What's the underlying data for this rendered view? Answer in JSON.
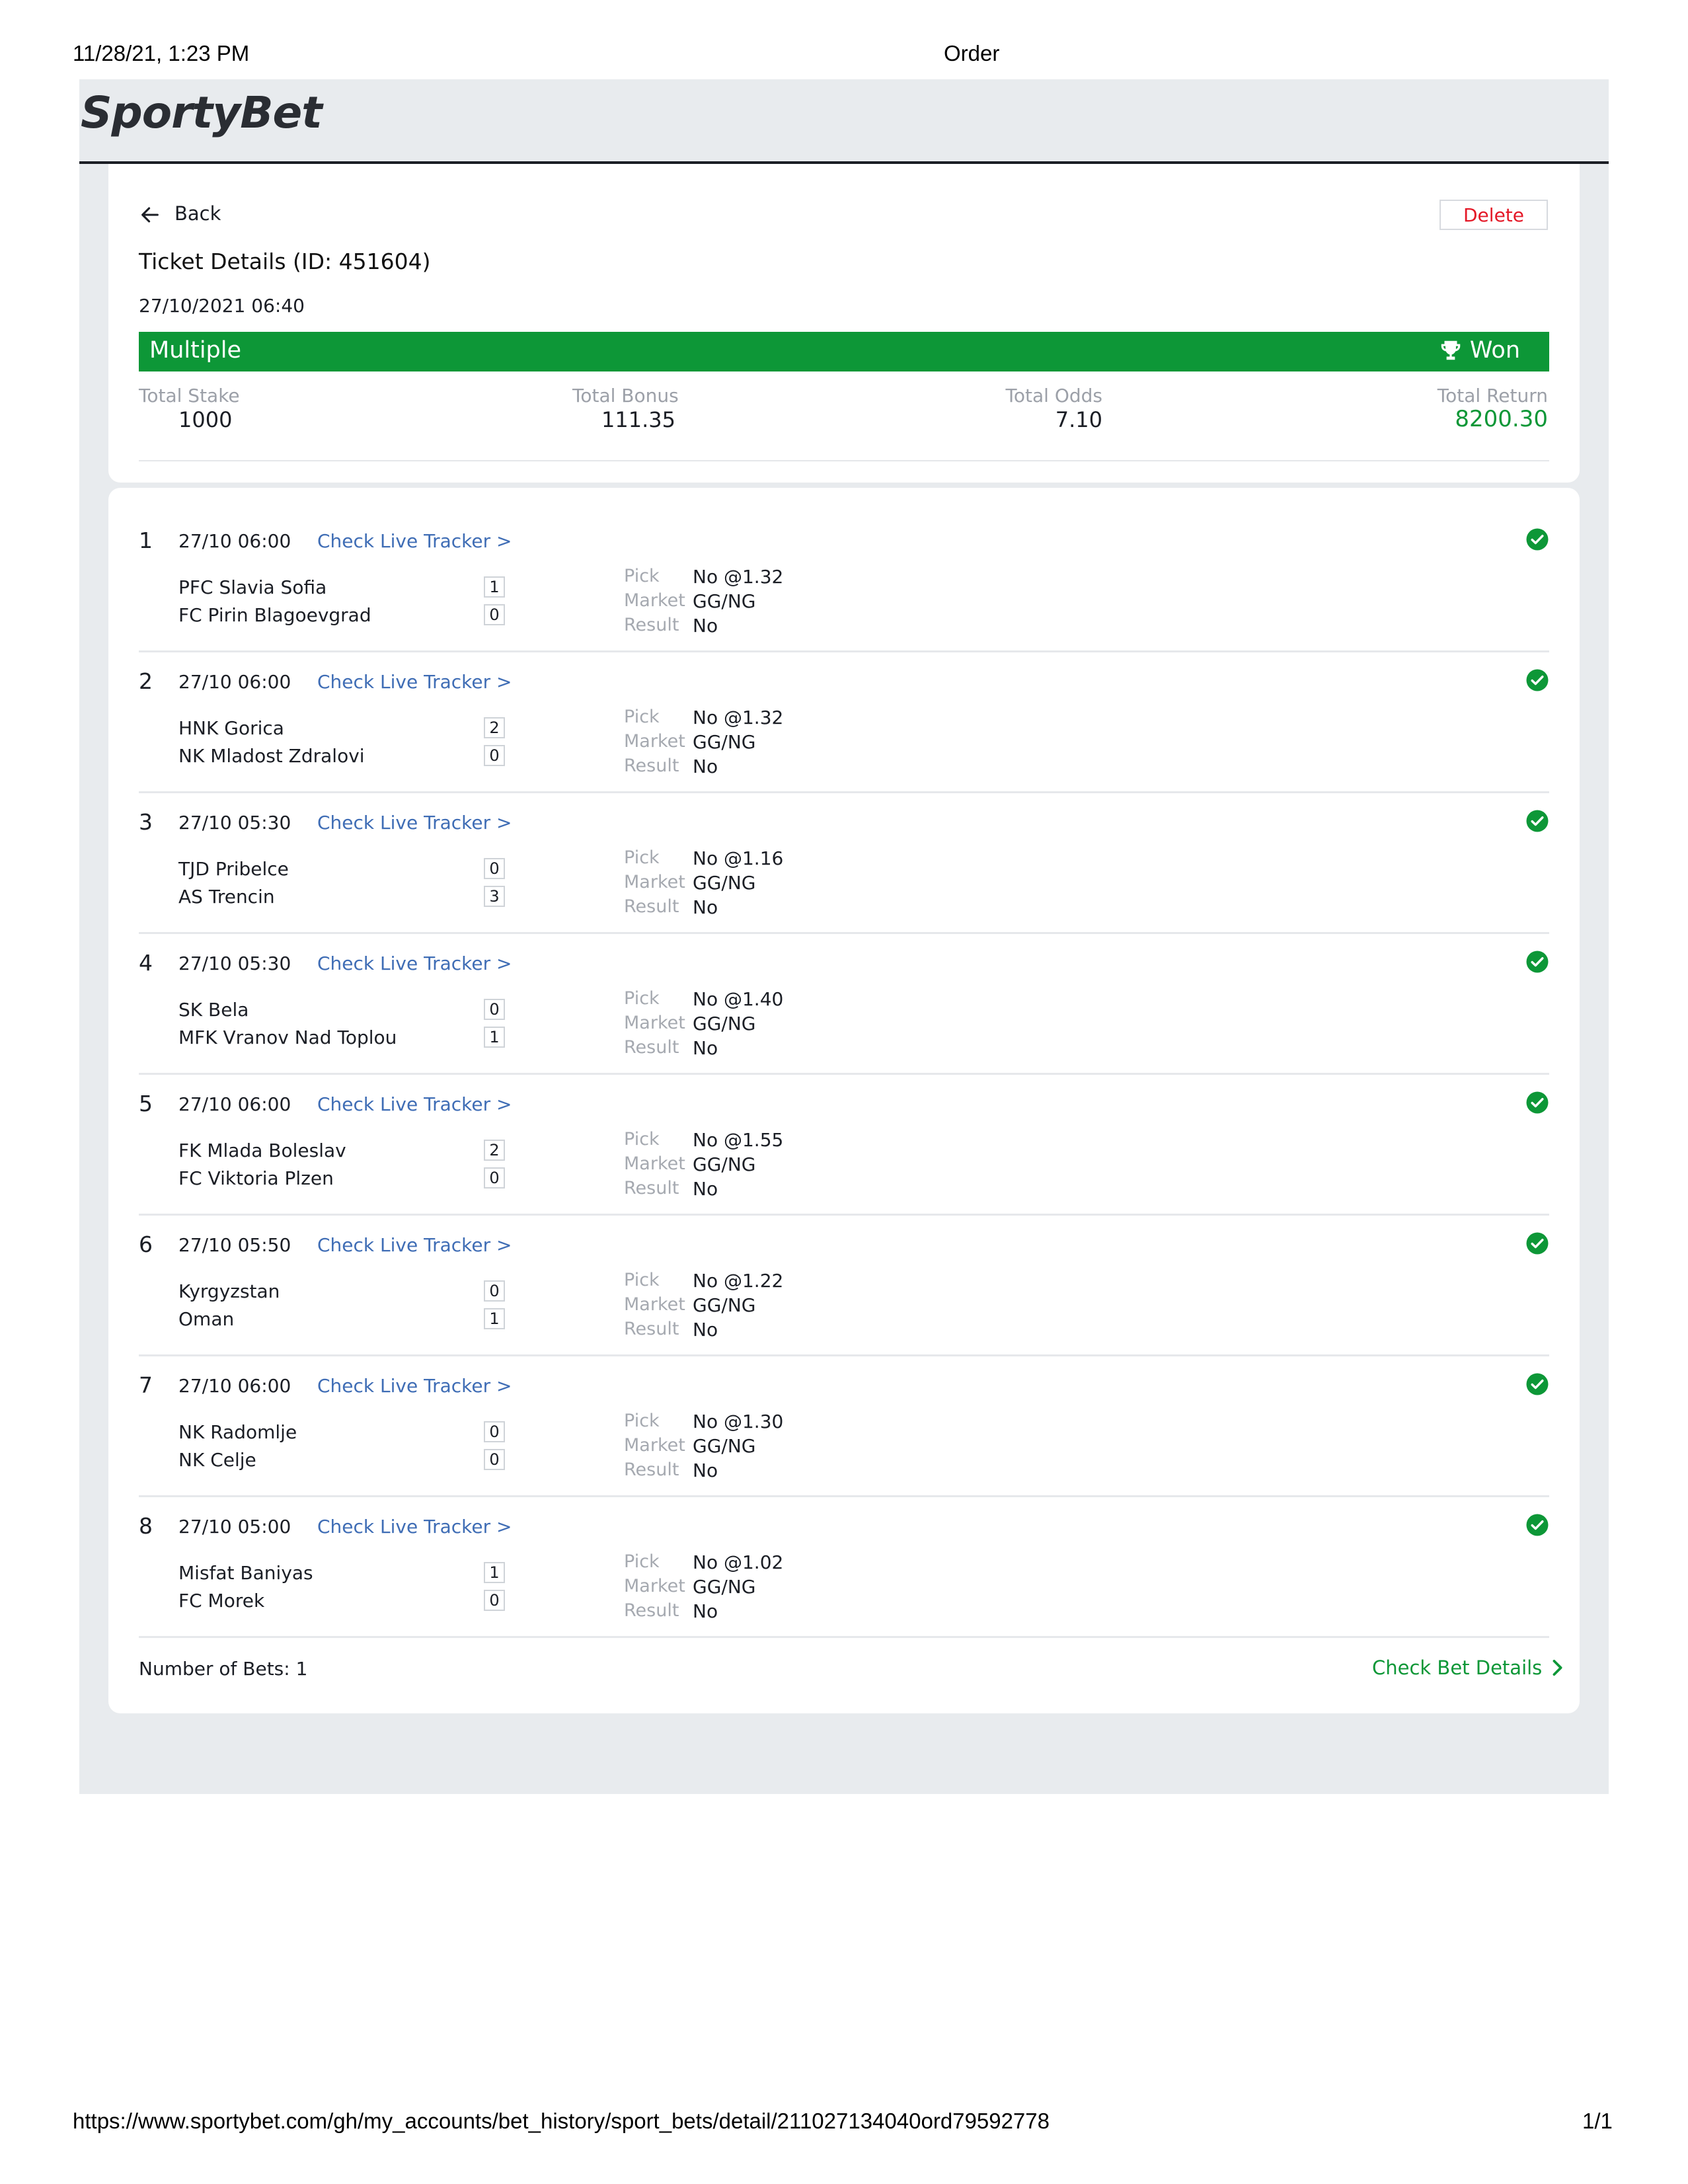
{
  "print_header": {
    "datetime": "11/28/21, 1:23 PM",
    "title": "Order"
  },
  "print_footer": {
    "url": "https://www.sportybet.com/gh/my_accounts/bet_history/sport_bets/detail/211027134040ord79592778",
    "page": "1/1"
  },
  "brand": {
    "logo_text": "SportyBet"
  },
  "ticket": {
    "back_label": "Back",
    "delete_label": "Delete",
    "title": "Ticket Details (ID: 451604)",
    "date": "27/10/2021 06:40",
    "bet_type": "Multiple",
    "status": "Won",
    "totals": {
      "stake_label": "Total Stake",
      "stake": "1000",
      "bonus_label": "Total Bonus",
      "bonus": "111.35",
      "odds_label": "Total Odds",
      "odds": "7.10",
      "return_label": "Total Return",
      "return": "8200.30"
    }
  },
  "labels": {
    "tracker": "Check Live Tracker >",
    "pick": "Pick",
    "market": "Market",
    "result": "Result"
  },
  "events": [
    {
      "num": "1",
      "time": "27/10 06:00",
      "home": "PFC Slavia Sofia",
      "away": "FC Pirin Blagoevgrad",
      "home_score": "1",
      "away_score": "0",
      "pick": "No @1.32",
      "market": "GG/NG",
      "result": "No"
    },
    {
      "num": "2",
      "time": "27/10 06:00",
      "home": "HNK Gorica",
      "away": "NK Mladost Zdralovi",
      "home_score": "2",
      "away_score": "0",
      "pick": "No @1.32",
      "market": "GG/NG",
      "result": "No"
    },
    {
      "num": "3",
      "time": "27/10 05:30",
      "home": "TJD Pribelce",
      "away": "AS Trencin",
      "home_score": "0",
      "away_score": "3",
      "pick": "No @1.16",
      "market": "GG/NG",
      "result": "No"
    },
    {
      "num": "4",
      "time": "27/10 05:30",
      "home": "SK Bela",
      "away": "MFK Vranov Nad Toplou",
      "home_score": "0",
      "away_score": "1",
      "pick": "No @1.40",
      "market": "GG/NG",
      "result": "No"
    },
    {
      "num": "5",
      "time": "27/10 06:00",
      "home": "FK Mlada Boleslav",
      "away": "FC Viktoria Plzen",
      "home_score": "2",
      "away_score": "0",
      "pick": "No @1.55",
      "market": "GG/NG",
      "result": "No"
    },
    {
      "num": "6",
      "time": "27/10 05:50",
      "home": "Kyrgyzstan",
      "away": "Oman",
      "home_score": "0",
      "away_score": "1",
      "pick": "No @1.22",
      "market": "GG/NG",
      "result": "No"
    },
    {
      "num": "7",
      "time": "27/10 06:00",
      "home": "NK Radomlje",
      "away": "NK Celje",
      "home_score": "0",
      "away_score": "0",
      "pick": "No @1.30",
      "market": "GG/NG",
      "result": "No"
    },
    {
      "num": "8",
      "time": "27/10 05:00",
      "home": "Misfat Baniyas",
      "away": "FC Morek",
      "home_score": "1",
      "away_score": "0",
      "pick": "No @1.02",
      "market": "GG/NG",
      "result": "No"
    }
  ],
  "footer": {
    "bets_count": "Number of Bets: 1",
    "check_details": "Check Bet Details"
  },
  "colors": {
    "won_green": "#0d9737",
    "link_blue": "#3f6db5",
    "delete_red": "#e41827",
    "frame_gray": "#e8ebee"
  },
  "icons": {
    "back": "arrow-left-icon",
    "won": "trophy-icon",
    "event_status": "check-circle-icon",
    "details": "chevron-right-icon"
  }
}
